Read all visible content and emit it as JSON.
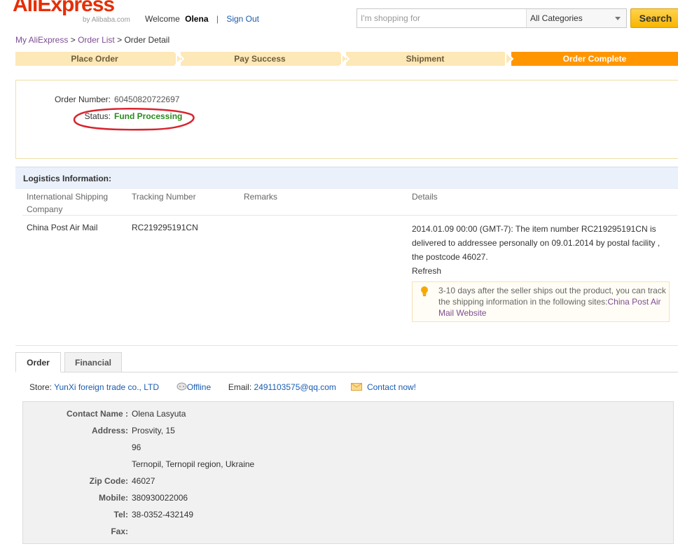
{
  "header": {
    "logo_text": "AliExpress",
    "logo_sub": "by Alibaba.com",
    "welcome_label": "Welcome",
    "user_name": "Olena",
    "separator": "|",
    "sign_out": "Sign Out"
  },
  "search": {
    "placeholder": "I'm shopping for",
    "category": "All Categories",
    "button": "Search"
  },
  "breadcrumb": {
    "items": [
      "My AliExpress",
      "Order List",
      "Order Detail"
    ],
    "separator": ">"
  },
  "steps": [
    "Place Order",
    "Pay Success",
    "Shipment",
    "Order Complete"
  ],
  "order": {
    "number_label": "Order Number:",
    "number": "60450820722697",
    "status_label": "Status:",
    "status": "Fund Processing"
  },
  "logistics": {
    "title": "Logistics Information:",
    "columns": [
      "International Shipping Company",
      "Tracking Number",
      "Remarks",
      "Details"
    ],
    "company": "China Post Air Mail",
    "tracking": "RC219295191CN",
    "details": "2014.01.09 00:00 (GMT-7): The item number RC219295191CN is delivered to addressee personally on 09.01.2014 by postal facility , the postcode 46027.",
    "refresh": "Refresh",
    "tip": "3-10 days after the seller ships out the product, you can track the shipping information in the following sites:",
    "tip_link": "China Post Air Mail Website"
  },
  "tabs": [
    "Order",
    "Financial"
  ],
  "store": {
    "store_label": "Store:",
    "store_name": "YunXi foreign trade co., LTD",
    "offline": "Offline",
    "email_label": "Email:",
    "email": "2491103575@qq.com",
    "contact": "Contact now!"
  },
  "contact": {
    "name_label": "Contact Name :",
    "name": "Olena Lasyuta",
    "address_label": "Address:",
    "address_line1": "Prosvity, 15",
    "address_line2": "96",
    "address_line3": "Ternopil, Ternopil region, Ukraine",
    "zip_label": "Zip Code:",
    "zip": "46027",
    "mobile_label": "Mobile:",
    "mobile": "380930022006",
    "tel_label": "Tel:",
    "tel": "38-0352-432149",
    "fax_label": "Fax:",
    "fax": ""
  },
  "colors": {
    "accent": "#ff9600",
    "status": "#2a8b1e",
    "link": "#1b5cb0",
    "annotation": "#d8242e"
  }
}
